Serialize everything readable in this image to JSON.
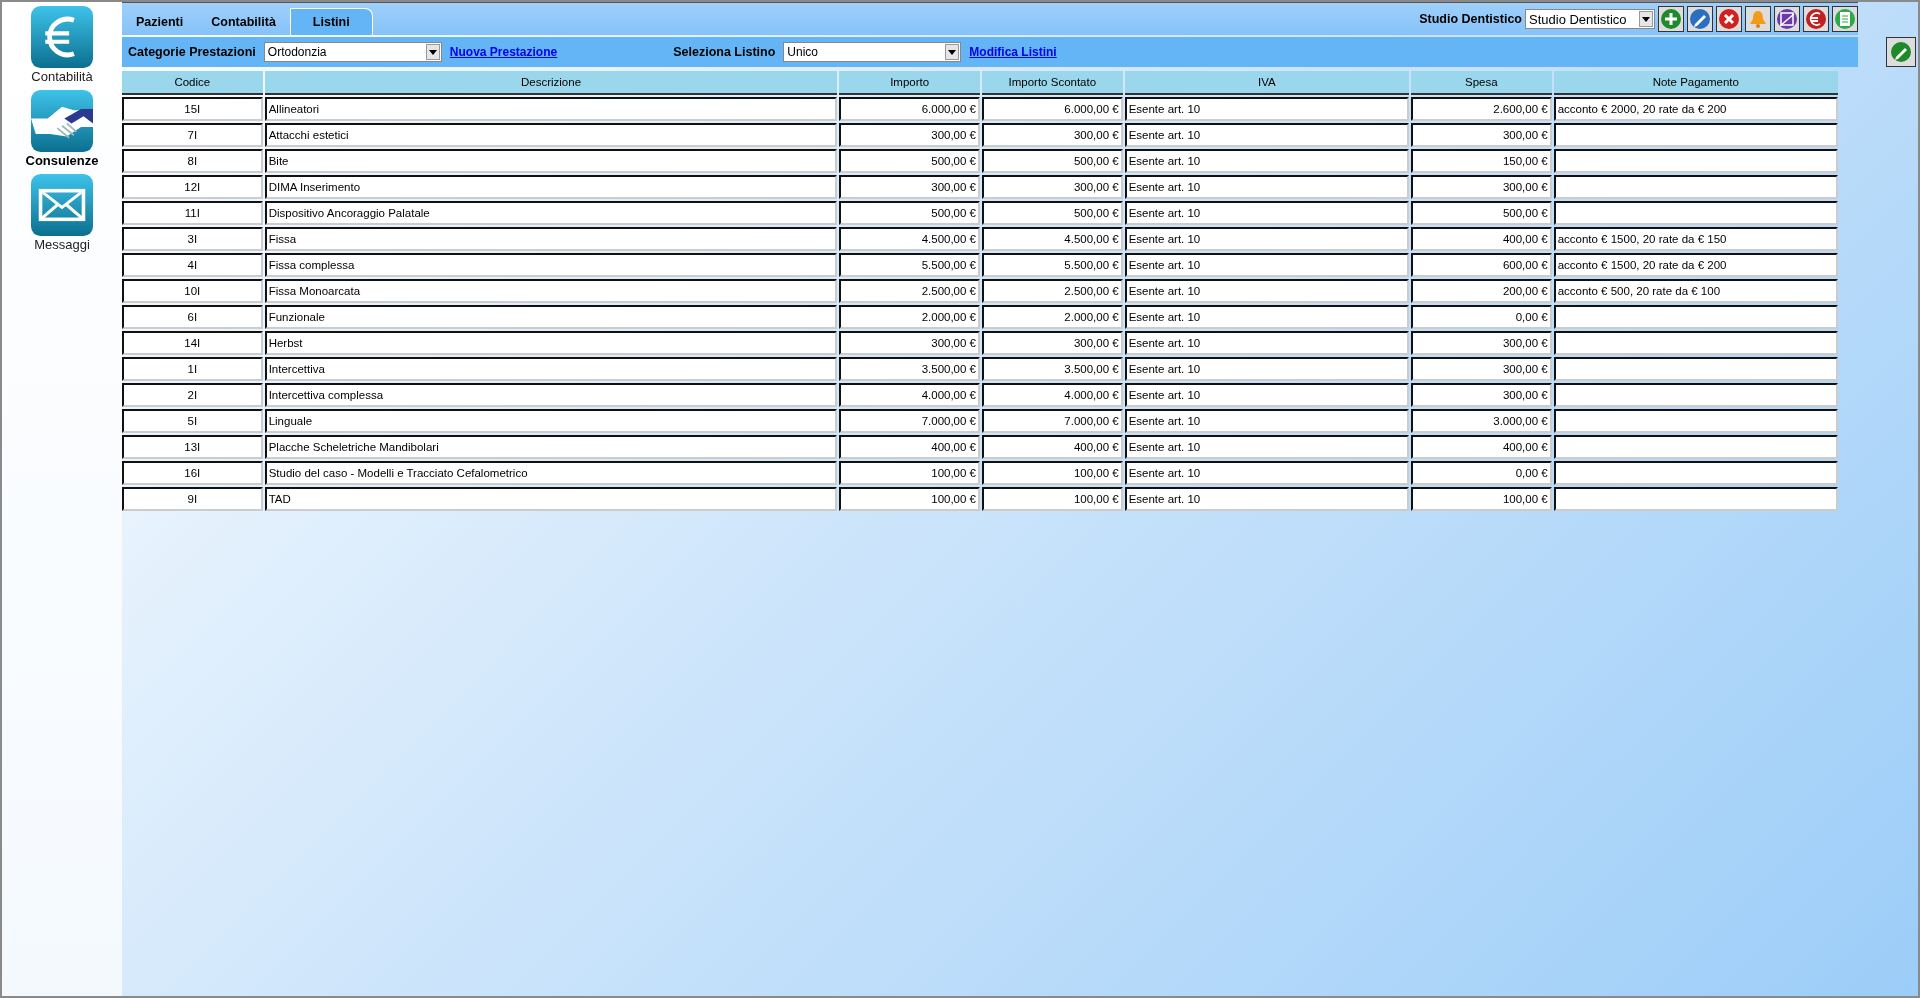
{
  "sidebar": {
    "items": [
      {
        "label": "Contabilità",
        "selected": false,
        "kind": "euro"
      },
      {
        "label": "Consulenze",
        "selected": true,
        "kind": "handshake"
      },
      {
        "label": "Messaggi",
        "selected": false,
        "kind": "mail"
      }
    ]
  },
  "tabs": [
    {
      "label": "Pazienti",
      "selected": false
    },
    {
      "label": "Contabilità",
      "selected": false
    },
    {
      "label": "Listini",
      "selected": true
    }
  ],
  "studio": {
    "label": "Studio Dentistico",
    "value": "Studio Dentistico"
  },
  "filters": {
    "category_label": "Categorie Prestazioni",
    "category_value": "Ortodonzia",
    "new_link": "Nuova Prestazione",
    "list_label": "Seleziona Listino",
    "list_value": "Unico",
    "edit_link": "Modifica Listini"
  },
  "table": {
    "columns": [
      "Codice",
      "Descrizione",
      "Importo",
      "Importo Scontato",
      "IVA",
      "Spesa",
      "Note Pagamento"
    ],
    "rows": [
      [
        "15I",
        "Allineatori",
        "6.000,00 €",
        "6.000,00 €",
        "Esente art. 10",
        "2.600,00 €",
        "acconto € 2000, 20 rate da € 200"
      ],
      [
        "7I",
        "Attacchi estetici",
        "300,00 €",
        "300,00 €",
        "Esente art. 10",
        "300,00 €",
        ""
      ],
      [
        "8I",
        "Bite",
        "500,00 €",
        "500,00 €",
        "Esente art. 10",
        "150,00 €",
        ""
      ],
      [
        "12I",
        "DIMA Inserimento",
        "300,00 €",
        "300,00 €",
        "Esente art. 10",
        "300,00 €",
        ""
      ],
      [
        "11I",
        "Dispositivo Ancoraggio Palatale",
        "500,00 €",
        "500,00 €",
        "Esente art. 10",
        "500,00 €",
        ""
      ],
      [
        "3I",
        "Fissa",
        "4.500,00 €",
        "4.500,00 €",
        "Esente art. 10",
        "400,00 €",
        "acconto € 1500, 20 rate da € 150"
      ],
      [
        "4I",
        "Fissa complessa",
        "5.500,00 €",
        "5.500,00 €",
        "Esente art. 10",
        "600,00 €",
        "acconto € 1500, 20 rate da € 200"
      ],
      [
        "10I",
        "Fissa Monoarcata",
        "2.500,00 €",
        "2.500,00 €",
        "Esente art. 10",
        "200,00 €",
        "acconto € 500, 20 rate da € 100"
      ],
      [
        "6I",
        "Funzionale",
        "2.000,00 €",
        "2.000,00 €",
        "Esente art. 10",
        "0,00 €",
        ""
      ],
      [
        "14I",
        "Herbst",
        "300,00 €",
        "300,00 €",
        "Esente art. 10",
        "300,00 €",
        ""
      ],
      [
        "1I",
        "Intercettiva",
        "3.500,00 €",
        "3.500,00 €",
        "Esente art. 10",
        "300,00 €",
        ""
      ],
      [
        "2I",
        "Intercettiva complessa",
        "4.000,00 €",
        "4.000,00 €",
        "Esente art. 10",
        "300,00 €",
        ""
      ],
      [
        "5I",
        "Linguale",
        "7.000,00 €",
        "7.000,00 €",
        "Esente art. 10",
        "3.000,00 €",
        ""
      ],
      [
        "13I",
        "Placche Scheletriche Mandibolari",
        "400,00 €",
        "400,00 €",
        "Esente art. 10",
        "400,00 €",
        ""
      ],
      [
        "16I",
        "Studio del caso - Modelli e Tracciato Cefalometrico",
        "100,00 €",
        "100,00 €",
        "Esente art. 10",
        "0,00 €",
        ""
      ],
      [
        "9I",
        "TAD",
        "100,00 €",
        "100,00 €",
        "Esente art. 10",
        "100,00 €",
        ""
      ]
    ]
  }
}
